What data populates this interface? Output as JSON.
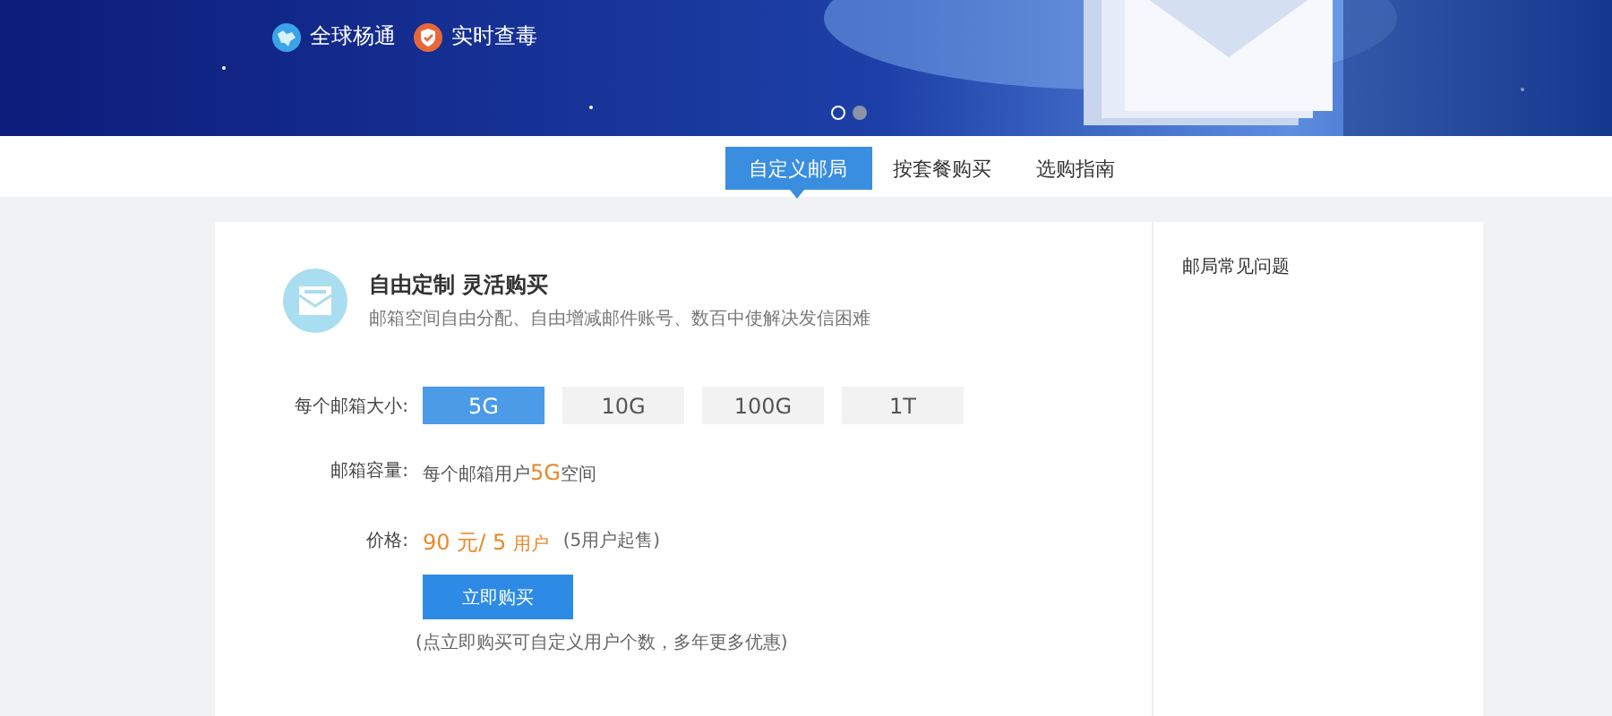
{
  "banner": {
    "features": [
      {
        "kind": "globe",
        "label": "全球杨通"
      },
      {
        "kind": "shield",
        "label": "实时查毒"
      }
    ],
    "dots": [
      {
        "selected": true
      },
      {
        "selected": false
      }
    ]
  },
  "tabs": [
    {
      "label": "自定义邮局",
      "selected": true
    },
    {
      "label": "按套餐购买",
      "selected": false
    },
    {
      "label": "选购指南",
      "selected": false
    }
  ],
  "intro": {
    "title": "自由定制 灵活购买",
    "description": "邮箱空间自由分配、自由增减邮件账号、数百中使解决发信困难"
  },
  "size": {
    "label": "每个邮箱大小:",
    "options": [
      {
        "label": "5G",
        "selected": true
      },
      {
        "label": "10G",
        "selected": false
      },
      {
        "label": "100G",
        "selected": false
      },
      {
        "label": "1T",
        "selected": false
      }
    ]
  },
  "capacity": {
    "label": "邮箱容量:",
    "prefix": "每个邮箱用户",
    "highlight": "5G",
    "suffix": "空间"
  },
  "price": {
    "label": "价格:",
    "amount": "90 元/ 5",
    "unit": "用户",
    "note": "(5用户起售)"
  },
  "buy_button": "立即购买",
  "footnote": "(点立即购买可自定义用户个数，多年更多优惠)",
  "sidebar": {
    "title": "邮局常见问题"
  }
}
